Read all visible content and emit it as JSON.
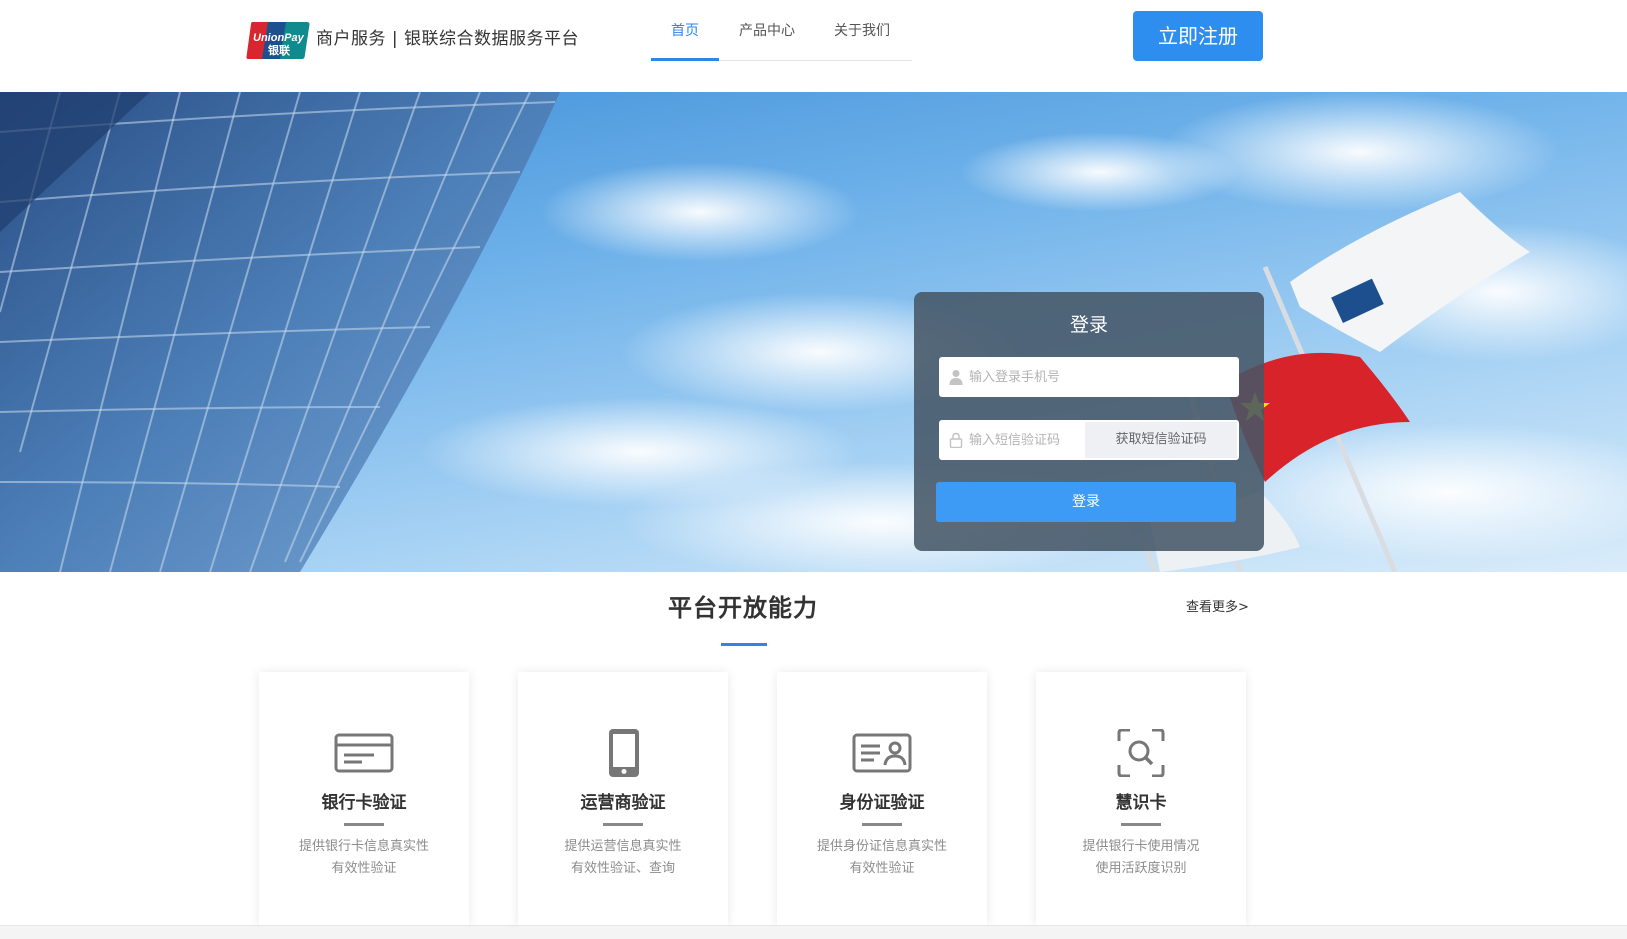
{
  "header": {
    "logo_text_top": "UnionPay",
    "logo_text_bottom": "银联",
    "platform_title": "商户服务 | 银联综合数据服务平台",
    "nav": [
      {
        "label": "首页",
        "active": true
      },
      {
        "label": "产品中心",
        "active": false
      },
      {
        "label": "关于我们",
        "active": false
      }
    ],
    "register_label": "立即注册"
  },
  "login": {
    "title": "登录",
    "phone_placeholder": "输入登录手机号",
    "phone_value": "",
    "sms_placeholder": "输入短信验证码",
    "sms_value": "",
    "sms_button": "获取短信验证码",
    "submit_label": "登录"
  },
  "section": {
    "title": "平台开放能力",
    "more_link": "查看更多>",
    "cards": [
      {
        "icon": "bank-card-icon",
        "title": "银行卡验证",
        "desc_line1": "提供银行卡信息真实性",
        "desc_line2": "有效性验证"
      },
      {
        "icon": "mobile-phone-icon",
        "title": "运营商验证",
        "desc_line1": "提供运营信息真实性",
        "desc_line2": "有效性验证、查询"
      },
      {
        "icon": "id-card-icon",
        "title": "身份证验证",
        "desc_line1": "提供身份证信息真实性",
        "desc_line2": "有效性验证"
      },
      {
        "icon": "scan-search-icon",
        "title": "慧识卡",
        "desc_line1": "提供银行卡使用情况",
        "desc_line2": "使用活跃度识别"
      }
    ]
  },
  "colors": {
    "accent": "#2f86e8",
    "register_button": "#2e8ef0",
    "login_button": "#3d9bf6",
    "login_panel": "#465666"
  }
}
